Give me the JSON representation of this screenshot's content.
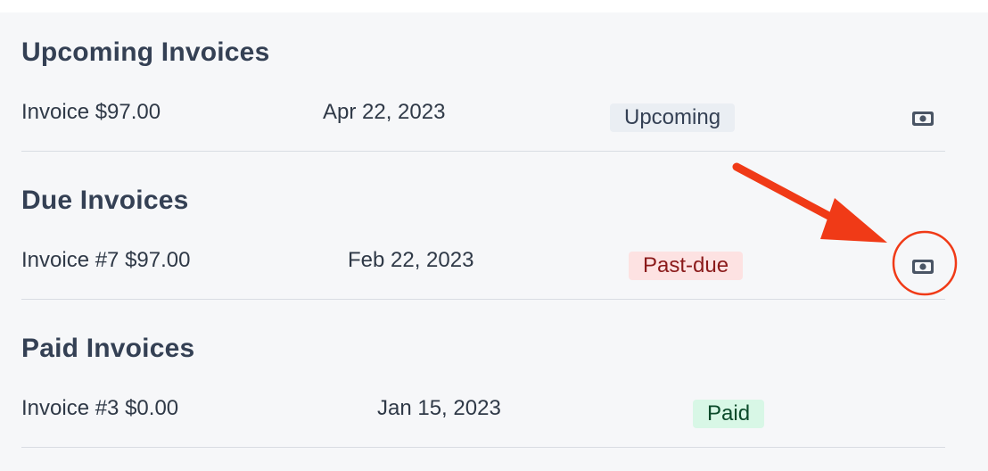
{
  "sections": [
    {
      "title": "Upcoming Invoices",
      "rows": [
        {
          "name": "Invoice $97.00",
          "date": "Apr 22, 2023",
          "status": "Upcoming"
        }
      ]
    },
    {
      "title": "Due Invoices",
      "rows": [
        {
          "name": "Invoice #7 $97.00",
          "date": "Feb 22, 2023",
          "status": "Past-due"
        }
      ]
    },
    {
      "title": "Paid Invoices",
      "rows": [
        {
          "name": "Invoice #3 $0.00",
          "date": "Jan 15, 2023",
          "status": "Paid"
        }
      ]
    }
  ],
  "icons": {
    "row_action": "pay-cash-icon",
    "annotation": "red-arrow-and-circle"
  },
  "colors": {
    "annotation": "#f03a17",
    "upcoming_badge": "#eaeef3",
    "pastdue_badge": "#fde2e2",
    "paid_badge": "#d8f7e6"
  }
}
